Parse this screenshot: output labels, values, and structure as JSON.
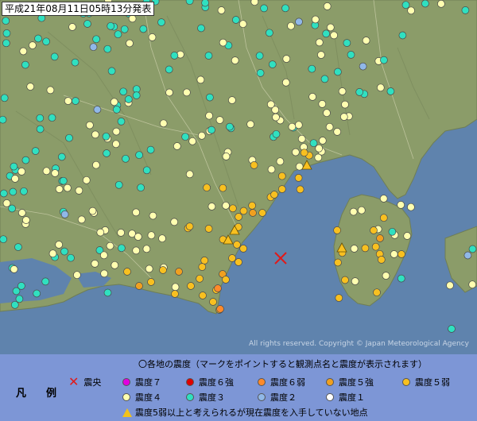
{
  "title": "平成21年08月11日05時13分発表",
  "copyright": "All rights reserved. Copyright © Japan Meteorological Agency",
  "colors": {
    "sea": "#5f83ad",
    "land": "#8a9a6a",
    "shindo7": "#e000e0",
    "shindo6_strong": "#e00000",
    "shindo6_weak": "#ff8a2a",
    "shindo5_strong": "#f0a020",
    "shindo5_weak": "#f8c020",
    "shindo4": "#ffffb0",
    "shindo3": "#30e0c0",
    "shindo2": "#90b8e8",
    "shindo1": "#ffffff",
    "epicenter": "#e01a1a"
  },
  "legend": {
    "label": "凡　例",
    "heading": "〇各地の震度（マークをポイントすると観測点名と震度が表示されます）",
    "epicenter": "震央",
    "shindo7": "震度７",
    "shindo6_strong": "震度６強",
    "shindo6_weak": "震度６弱",
    "shindo5_strong": "震度５強",
    "shindo5_weak": "震度５弱",
    "shindo4": "震度４",
    "shindo3": "震度３",
    "shindo2": "震度２",
    "shindo1": "震度１",
    "unknown": "震度5弱以上と考えられるが現在震度を入手していない地点"
  }
}
